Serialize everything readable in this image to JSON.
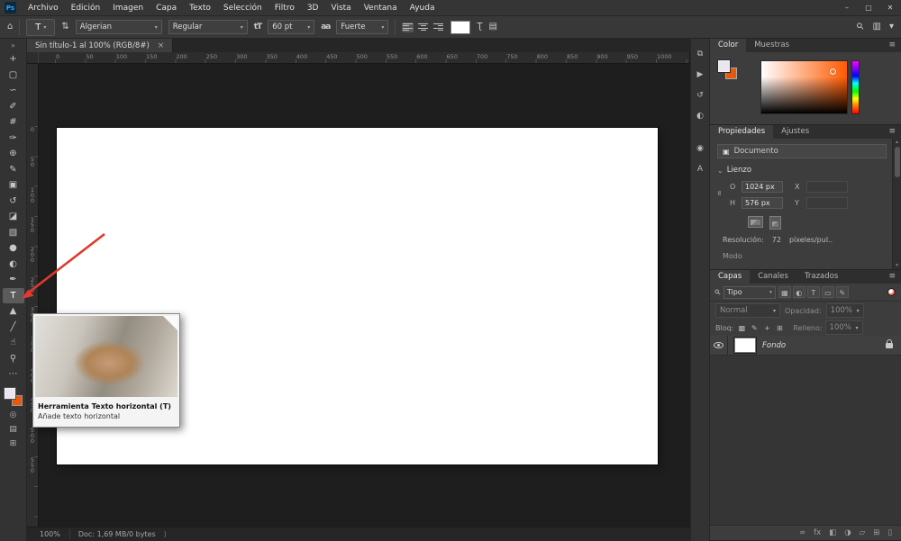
{
  "ui": {
    "dropdown_arrow": "▾",
    "menu_icon": "≡",
    "chevron_down": "⌄",
    "scroll_up": "▴",
    "scroll_down": "▾",
    "tab_close": "×"
  },
  "titlebar": {
    "logo": "Ps",
    "menus": [
      "Archivo",
      "Edición",
      "Imagen",
      "Capa",
      "Texto",
      "Selección",
      "Filtro",
      "3D",
      "Vista",
      "Ventana",
      "Ayuda"
    ],
    "minimize": "–",
    "maximize": "▢",
    "close": "✕"
  },
  "options_bar": {
    "home_icon": "⌂",
    "tool_abbrev": "T",
    "orientation_icon": "⇅",
    "font_family": "Algerian",
    "font_style": "Regular",
    "size_icon": "tT",
    "font_size": "60 pt",
    "antialias_icon": "aa",
    "antialias": "Fuerte",
    "swatch_color": "#ffffff",
    "warp_icon": "Ʈ",
    "panels_icon": "▤",
    "search_icon": "⚲",
    "workspace_icon": "▥"
  },
  "document_tab": {
    "title": "Sin título-1 al 100% (RGB/8#)"
  },
  "rulers": {
    "horizontal": [
      "0",
      "50",
      "100",
      "150",
      "200",
      "250",
      "300",
      "350",
      "400",
      "450",
      "500",
      "550",
      "600",
      "650",
      "700",
      "750",
      "800",
      "850",
      "900",
      "950",
      "1000"
    ],
    "vertical": [
      "0",
      "50",
      "100",
      "150",
      "200",
      "250",
      "300",
      "350",
      "400",
      "450",
      "500",
      "550"
    ]
  },
  "toolbar": {
    "collapse_icon": "»",
    "foreground_color": "#e9e6f2",
    "background_color": "#e8590c",
    "tools": [
      {
        "name": "move-tool",
        "glyph": "+"
      },
      {
        "name": "marquee-tool",
        "glyph": "▢"
      },
      {
        "name": "lasso-tool",
        "glyph": "∽"
      },
      {
        "name": "quick-selection-tool",
        "glyph": "✐"
      },
      {
        "name": "crop-tool",
        "glyph": "#"
      },
      {
        "name": "eyedropper-tool",
        "glyph": "✑"
      },
      {
        "name": "healing-brush-tool",
        "glyph": "⊕"
      },
      {
        "name": "brush-tool",
        "glyph": "✎"
      },
      {
        "name": "clone-stamp-tool",
        "glyph": "▣"
      },
      {
        "name": "history-brush-tool",
        "glyph": "↺"
      },
      {
        "name": "eraser-tool",
        "glyph": "◪"
      },
      {
        "name": "gradient-tool",
        "glyph": "▧"
      },
      {
        "name": "blur-tool",
        "glyph": "●"
      },
      {
        "name": "dodge-tool",
        "glyph": "◐"
      },
      {
        "name": "pen-tool",
        "glyph": "✒"
      },
      {
        "name": "type-tool",
        "glyph": "T",
        "selected": true
      },
      {
        "name": "path-selection-tool",
        "glyph": "▲"
      },
      {
        "name": "shape-tool",
        "glyph": "╱"
      },
      {
        "name": "hand-tool",
        "glyph": "☝"
      },
      {
        "name": "zoom-tool",
        "glyph": "⚲"
      },
      {
        "name": "edit-toolbar-icon",
        "glyph": "⋯"
      }
    ],
    "bottom_icons": [
      {
        "name": "quick-mask-icon",
        "glyph": "◎"
      },
      {
        "name": "screen-mode-icon",
        "glyph": "▤"
      },
      {
        "name": "frame-mode-icon",
        "glyph": "⊞"
      }
    ]
  },
  "tooltip": {
    "title": "Herramienta Texto horizontal (T)",
    "description": "Añade texto horizontal"
  },
  "dock_strip": [
    {
      "name": "libraries-panel-icon",
      "glyph": "⧉"
    },
    {
      "name": "actions-panel-icon",
      "glyph": "▶"
    },
    {
      "name": "history-panel-icon",
      "glyph": "↺"
    },
    {
      "name": "adjustments-panel-icon",
      "glyph": "◐"
    },
    {
      "name": "info-panel-icon",
      "glyph": "◉"
    },
    {
      "name": "character-panel-icon",
      "glyph": "A"
    }
  ],
  "color_panel": {
    "tabs": [
      "Color",
      "Muestras"
    ],
    "hue_color": "#ff5a00",
    "foreground_color": "#e9e6f2",
    "background_color": "#e8590c"
  },
  "properties_panel": {
    "tabs": [
      "Propiedades",
      "Ajustes"
    ],
    "document_icon": "▣",
    "document_label": "Documento",
    "section_label": "Lienzo",
    "link_icon": "∞",
    "fields": {
      "w_label": "O",
      "w_value": "1024 px",
      "x_label": "X",
      "x_value": "",
      "h_label": "H",
      "h_value": "576 px",
      "y_label": "Y",
      "y_value": ""
    },
    "resolution_label": "Resolución:",
    "resolution_value": "72",
    "resolution_unit": "píxeles/pul..",
    "mode_label": "Modo"
  },
  "layers_panel": {
    "tabs": [
      "Capas",
      "Canales",
      "Trazados"
    ],
    "search_icon": "⚲",
    "filter_value": "Tipo",
    "filter_icons": [
      {
        "name": "filter-pixel-layers-icon",
        "glyph": "▦"
      },
      {
        "name": "filter-adjustment-layers-icon",
        "glyph": "◐"
      },
      {
        "name": "filter-type-layers-icon",
        "glyph": "T"
      },
      {
        "name": "filter-shape-layers-icon",
        "glyph": "▭"
      },
      {
        "name": "filter-smart-objects-icon",
        "glyph": "✎"
      }
    ],
    "blend_mode": "Normal",
    "opacity_label": "Opacidad:",
    "opacity_value": "100%",
    "lock_label": "Bloq:",
    "lock_icons": [
      {
        "name": "lock-transparency-icon",
        "glyph": "▩"
      },
      {
        "name": "lock-pixels-icon",
        "glyph": "✎"
      },
      {
        "name": "lock-position-icon",
        "glyph": "+"
      },
      {
        "name": "lock-artboard-icon",
        "glyph": "⊞"
      }
    ],
    "fill_label": "Relleno:",
    "fill_value": "100%",
    "layer_name": "Fondo",
    "bottom_icons": [
      {
        "name": "link-layers-icon",
        "glyph": "∞"
      },
      {
        "name": "layer-effects-icon",
        "glyph": "fx"
      },
      {
        "name": "layer-mask-icon",
        "glyph": "◧"
      },
      {
        "name": "adjustment-layer-icon",
        "glyph": "◑"
      },
      {
        "name": "layer-group-icon",
        "glyph": "▱"
      },
      {
        "name": "new-layer-icon",
        "glyph": "⊞"
      },
      {
        "name": "delete-layer-icon",
        "glyph": "▯"
      }
    ]
  },
  "statusbar": {
    "zoom": "100%",
    "doc_info": "Doc: 1,69 MB/0 bytes",
    "chevron": "⟩"
  }
}
